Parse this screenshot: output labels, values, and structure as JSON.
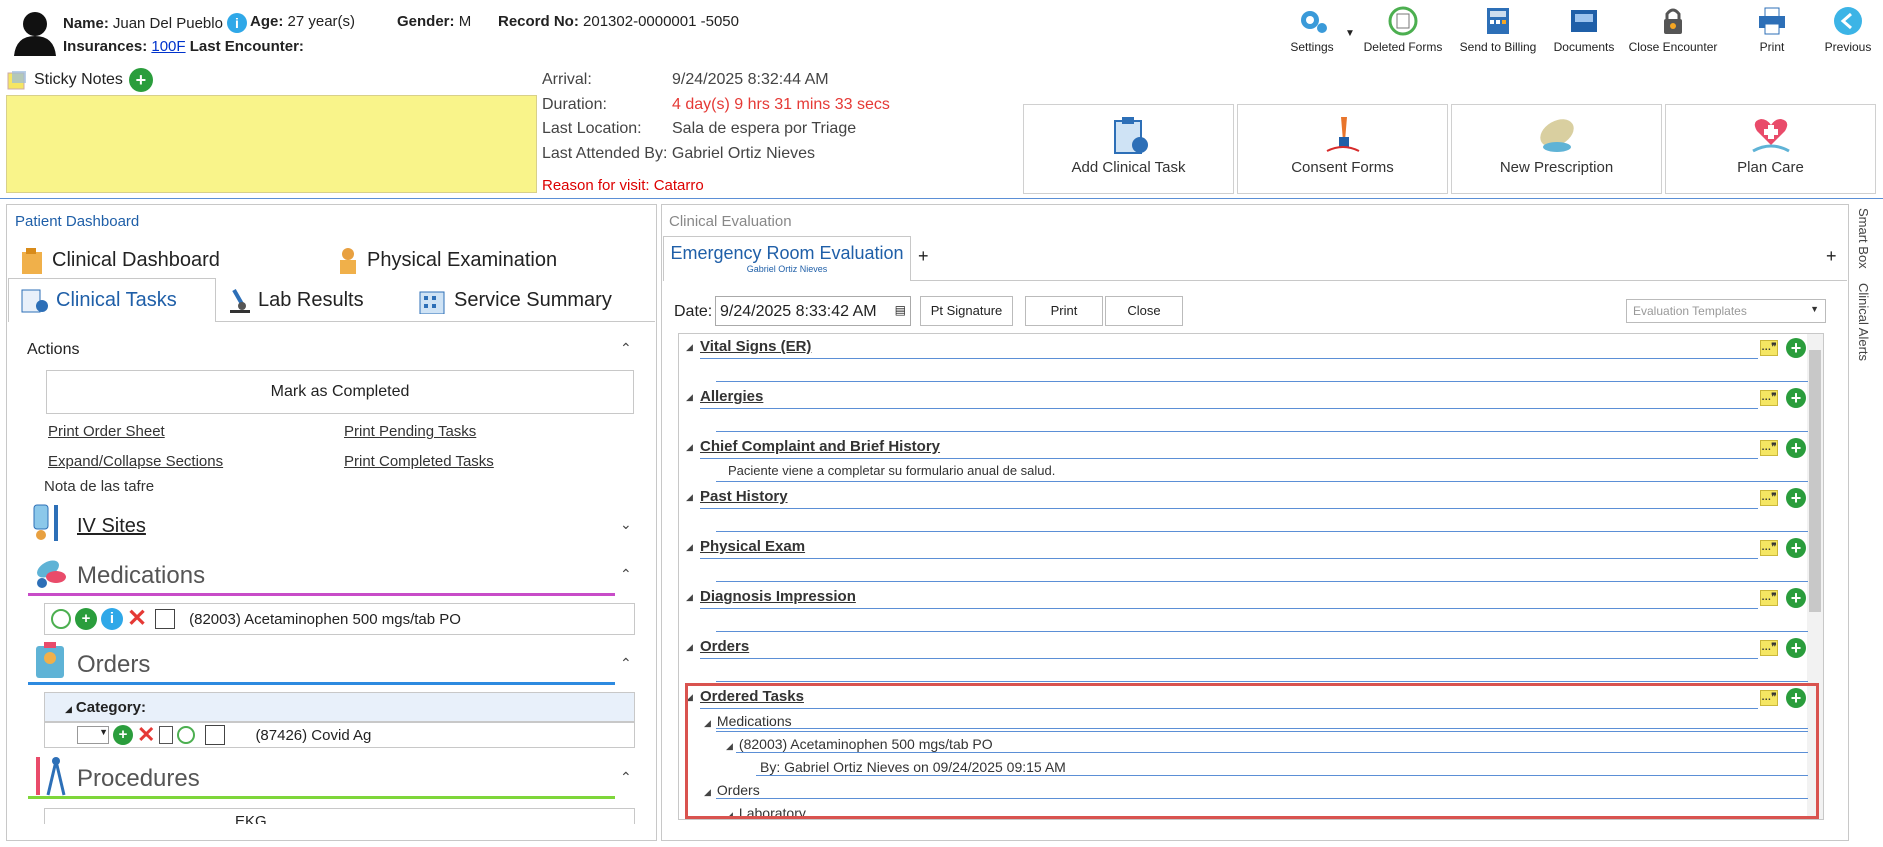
{
  "patient": {
    "name_label": "Name:",
    "name": "Juan Del Pueblo",
    "age_label": "Age:",
    "age": "27 year(s)",
    "gender_label": "Gender:",
    "gender": "M",
    "record_label": "Record No:",
    "record": "201302-0000001 -5050",
    "ins_label": "Insurances:",
    "ins_value": "100F",
    "last_enc_label": "Last Encounter:"
  },
  "toolbar": {
    "settings": "Settings",
    "deleted": "Deleted Forms",
    "billing": "Send to Billing",
    "documents": "Documents",
    "close_enc": "Close Encounter",
    "print": "Print",
    "previous": "Previous"
  },
  "sticky": {
    "label": "Sticky Notes"
  },
  "visit": {
    "arrival_label": "Arrival:",
    "arrival": "9/24/2025 8:32:44 AM",
    "duration_label": "Duration:",
    "duration": "4 day(s) 9 hrs 31 mins 33 secs",
    "location_label": "Last Location:",
    "location": "Sala de espera por Triage",
    "attended_label": "Last Attended By:",
    "attended": "Gabriel Ortiz Nieves",
    "reason": "Reason for visit: Catarro"
  },
  "actions": {
    "add_task": "Add Clinical Task",
    "consent": "Consent Forms",
    "prescription": "New Prescription",
    "plan": "Plan Care"
  },
  "left": {
    "title": "Patient Dashboard",
    "tab_dashboard": "Clinical Dashboard",
    "tab_physical": "Physical Examination",
    "tab_tasks": "Clinical Tasks",
    "tab_lab": "Lab Results",
    "tab_service": "Service Summary",
    "actions_label": "Actions",
    "mark_completed": "Mark as Completed",
    "print_order": "Print Order Sheet",
    "print_pending": "Print Pending Tasks",
    "expand": "Expand/Collapse Sections",
    "print_completed": "Print Completed Tasks",
    "nota": "Nota de las tafre",
    "iv": "IV Sites",
    "medications": "Medications",
    "med_item": "(82003) Acetaminophen 500 mgs/tab PO",
    "orders": "Orders",
    "category": "Category:",
    "order_item": "(87426) Covid Ag",
    "procedures": "Procedures",
    "proc_item": "EKG"
  },
  "right": {
    "title": "Clinical Evaluation",
    "tab": "Emergency Room Evaluation",
    "tab_sub": "Gabriel Ortiz Nieves",
    "date_label": "Date:",
    "date": "9/24/2025 8:33:42 AM",
    "pt_sig": "Pt Signature",
    "print": "Print",
    "close": "Close",
    "templates": "Evaluation Templates",
    "side1": "Smart Box",
    "side2": "Clinical Alerts"
  },
  "sections": [
    {
      "label": "Vital Signs (ER)"
    },
    {
      "label": "Allergies"
    },
    {
      "label": "Chief Complaint and Brief History",
      "content": "Paciente viene a completar su formulario anual de salud."
    },
    {
      "label": "Past History"
    },
    {
      "label": "Physical Exam"
    },
    {
      "label": "Diagnosis Impression"
    },
    {
      "label": "Orders"
    },
    {
      "label": "Ordered Tasks"
    }
  ],
  "ordered": {
    "medications": "Medications",
    "med": "(82003) Acetaminophen 500 mgs/tab PO",
    "by": "By: Gabriel Ortiz Nieves on 09/24/2025 09:15 AM",
    "orders": "Orders",
    "lab": "Laboratory"
  }
}
